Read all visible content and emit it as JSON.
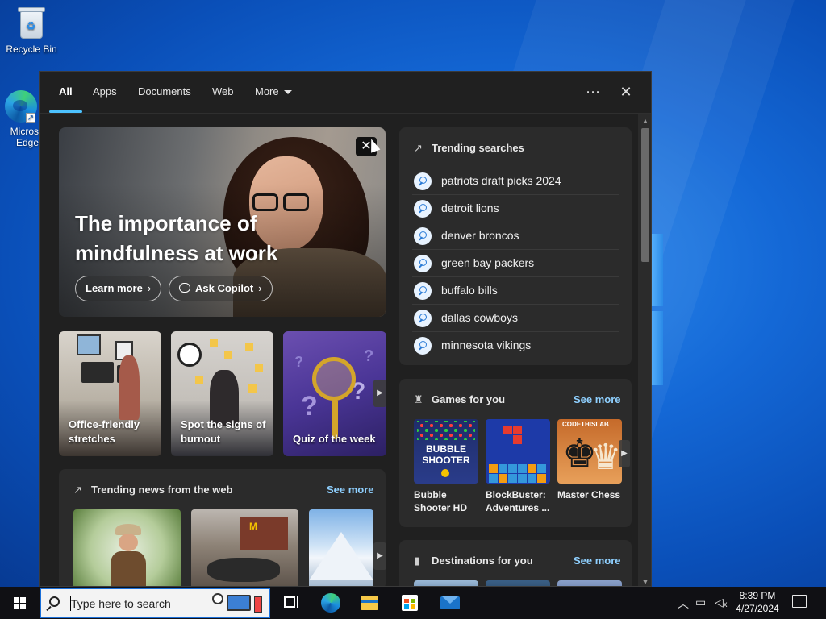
{
  "desktop": {
    "icons": [
      {
        "label": "Recycle Bin"
      },
      {
        "label": "Micros Edge"
      }
    ]
  },
  "flyout": {
    "tabs": [
      {
        "label": "All",
        "active": true
      },
      {
        "label": "Apps"
      },
      {
        "label": "Documents"
      },
      {
        "label": "Web"
      },
      {
        "label": "More"
      }
    ],
    "more_options_icon": "⋯",
    "close_icon": "✕"
  },
  "hero": {
    "title": "The importance of mindfulness at work",
    "learn_more": "Learn more",
    "ask_copilot": "Ask Copilot"
  },
  "tiles": [
    {
      "label": "Office-friendly stretches"
    },
    {
      "label": "Spot the signs of burnout"
    },
    {
      "label": "Quiz of the week"
    }
  ],
  "trending_news": {
    "header": "Trending news from the web",
    "see_more": "See more"
  },
  "trending_searches": {
    "header": "Trending searches",
    "items": [
      "patriots draft picks 2024",
      "detroit lions",
      "denver broncos",
      "green bay packers",
      "buffalo bills",
      "dallas cowboys",
      "minnesota vikings"
    ]
  },
  "games": {
    "header": "Games for you",
    "see_more": "See more",
    "items": [
      {
        "title": "Bubble Shooter HD",
        "art_text": "BUBBLE SHOOTER"
      },
      {
        "title": "BlockBuster: Adventures ..."
      },
      {
        "title": "Master Chess",
        "art_text": "CODETHISLAB"
      }
    ]
  },
  "destinations": {
    "header": "Destinations for you",
    "see_more": "See more"
  },
  "taskbar": {
    "search_placeholder": "Type here to search",
    "clock_time": "8:39 PM",
    "clock_date": "4/27/2024"
  },
  "colors": {
    "accent": "#4cc2ff",
    "link": "#8fd0ff",
    "flyout_bg": "#202020",
    "card_bg": "#2b2b2b",
    "taskbar_bg": "#101014"
  }
}
